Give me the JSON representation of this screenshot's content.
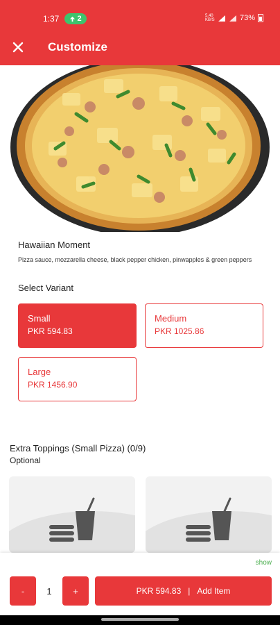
{
  "status_bar": {
    "time": "1:37",
    "notification_count": "2",
    "battery": "73%",
    "network_label": "5.40 KB/S"
  },
  "header": {
    "title": "Customize",
    "close_icon": "close-icon"
  },
  "item": {
    "name": "Hawaiian Moment",
    "description": "Pizza sauce, mozzarella cheese, black pepper chicken, pinwapples & green peppers"
  },
  "variants": {
    "heading": "Select Variant",
    "options": [
      {
        "name": "Small",
        "price": "PKR 594.83",
        "selected": true
      },
      {
        "name": "Medium",
        "price": "PKR 1025.86",
        "selected": false
      },
      {
        "name": "Large",
        "price": "PKR 1456.90",
        "selected": false
      }
    ]
  },
  "toppings": {
    "heading": "Extra Toppings (Small Pizza) (0/9)",
    "optional_label": "Optional",
    "placeholder_icon": "burger-drink-placeholder-icon"
  },
  "bottom_bar": {
    "show_label": "show",
    "minus_label": "-",
    "quantity": "1",
    "plus_label": "+",
    "total_price": "PKR 594.83",
    "separator": "|",
    "add_label": "Add Item"
  },
  "colors": {
    "accent": "#e8383a",
    "link_green": "#4caf50"
  }
}
